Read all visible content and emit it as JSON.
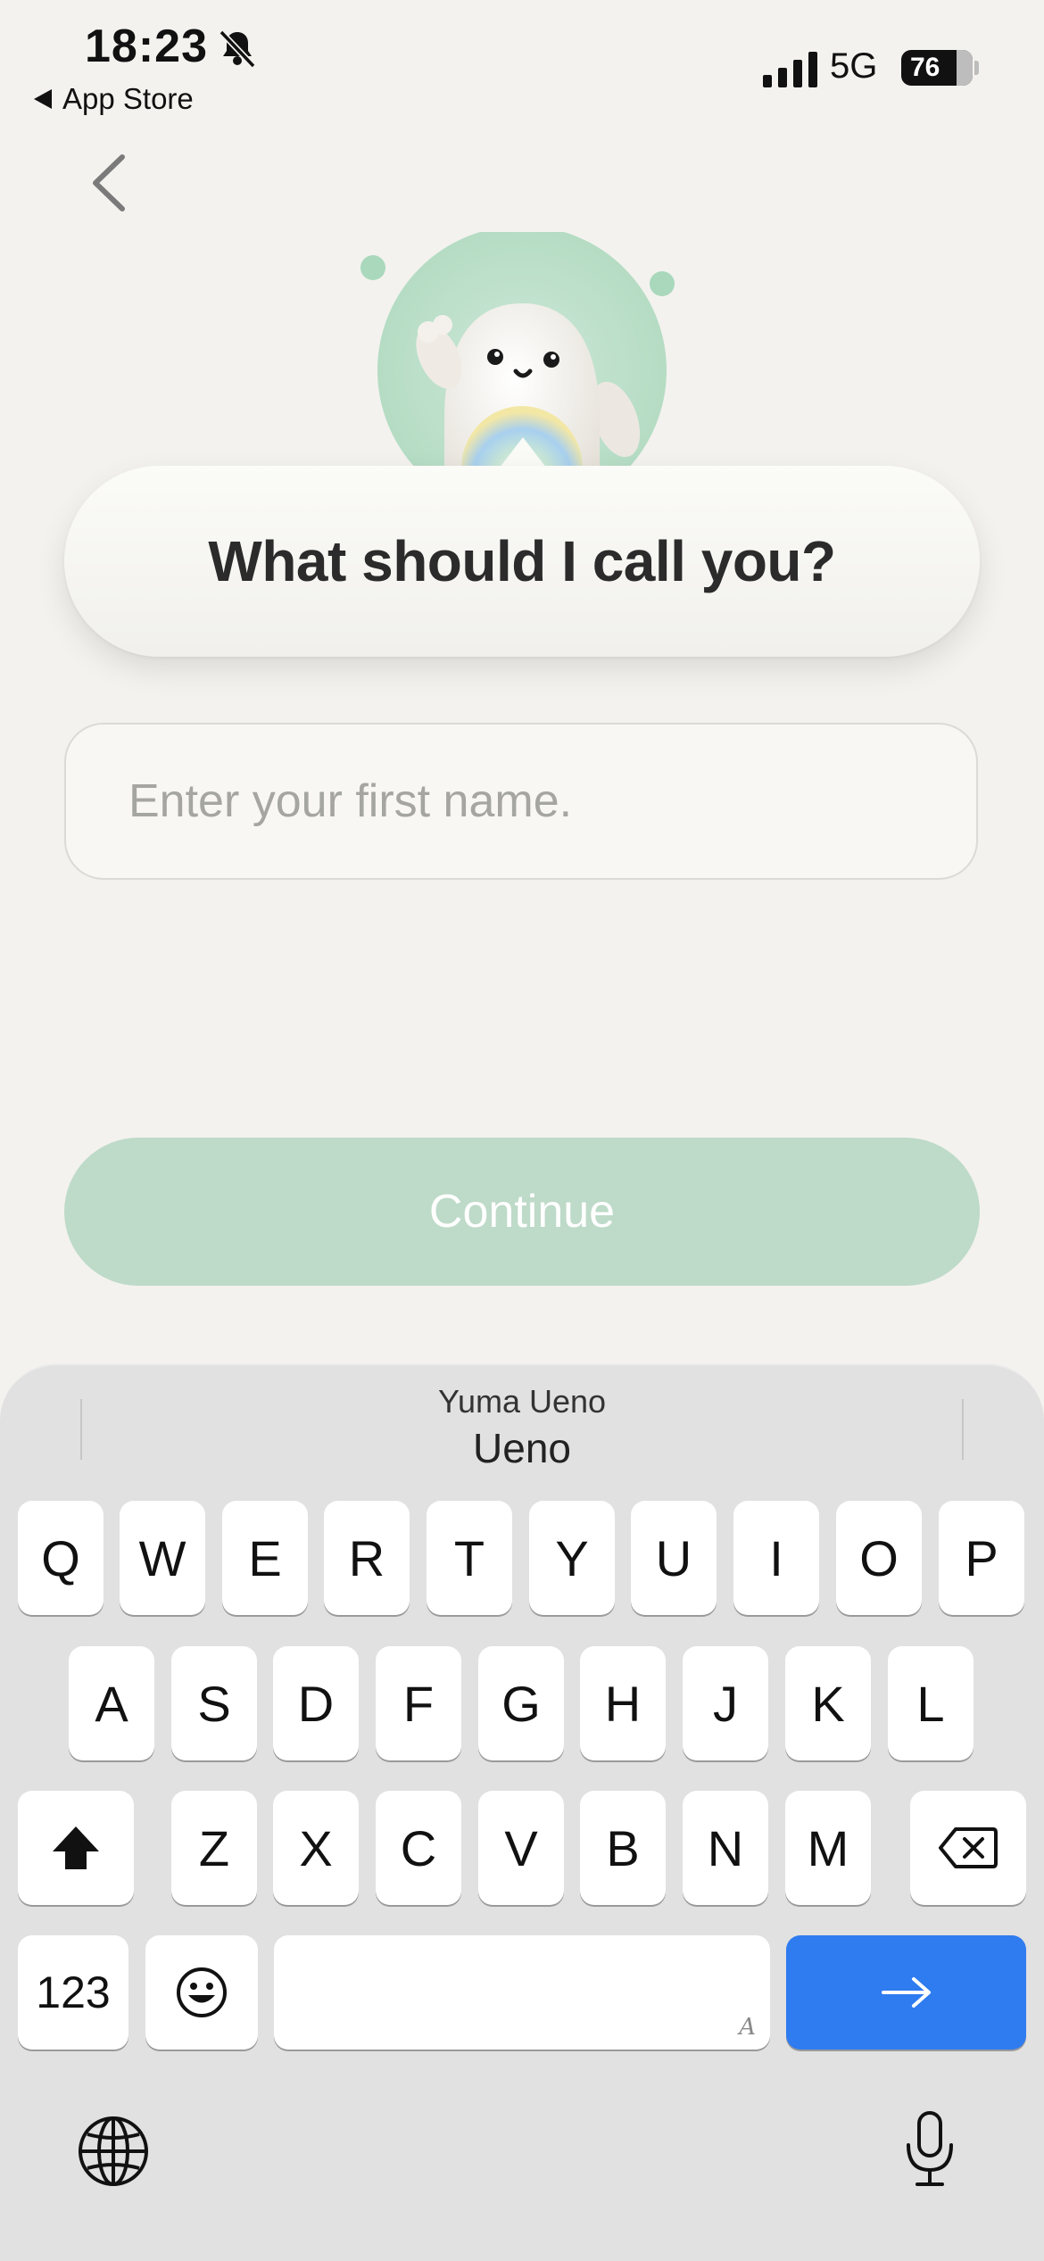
{
  "status_bar": {
    "time": "18:23",
    "back_app_label": "App Store",
    "network": "5G",
    "battery": "76"
  },
  "icons": {
    "nav_back": "chevron-left-icon",
    "bell": "bell-slash-icon",
    "shift": "shift-icon",
    "delete": "backspace-icon",
    "emoji": "emoji-icon",
    "globe": "globe-icon",
    "mic": "microphone-icon",
    "return": "arrow-right-icon"
  },
  "prompt": {
    "title": "What should I call you?"
  },
  "name_input": {
    "placeholder": "Enter your first name.",
    "value": ""
  },
  "continue_button": {
    "label": "Continue",
    "color": "#bedac8"
  },
  "keyboard": {
    "suggestion_secondary": "Yuma Ueno",
    "suggestion_primary": "Ueno",
    "row1": [
      "Q",
      "W",
      "E",
      "R",
      "T",
      "Y",
      "U",
      "I",
      "O",
      "P"
    ],
    "row2": [
      "A",
      "S",
      "D",
      "F",
      "G",
      "H",
      "J",
      "K",
      "L"
    ],
    "row3": [
      "Z",
      "X",
      "C",
      "V",
      "B",
      "N",
      "M"
    ],
    "numbers_label": "123",
    "space_hint": "A",
    "return_color": "#2f7bf0"
  }
}
